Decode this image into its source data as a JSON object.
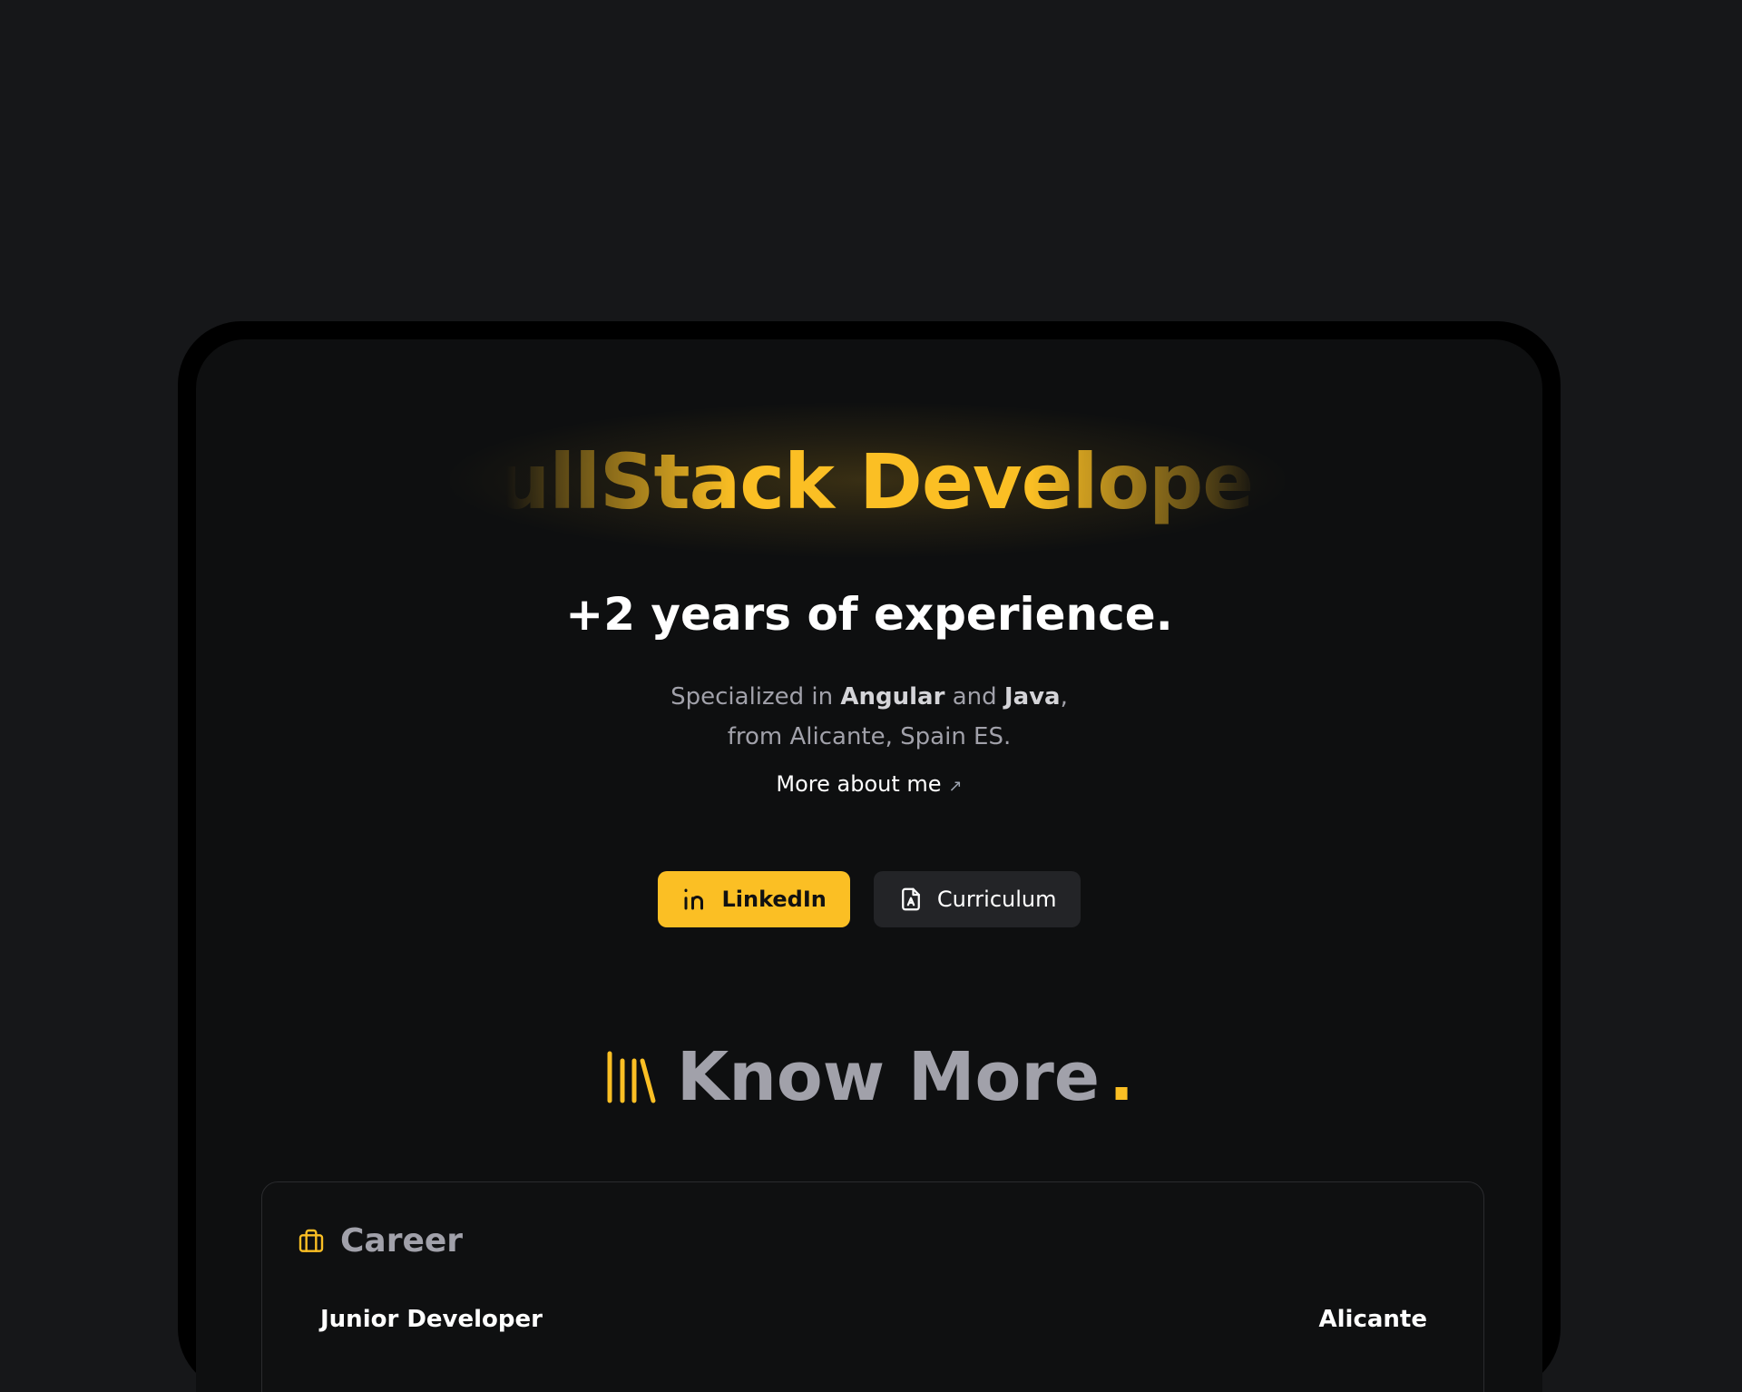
{
  "hero": {
    "title": "FullStack Developer",
    "subtitle": "+2 years of experience.",
    "desc_prefix": "Specialized in ",
    "desc_skill_1": "Angular",
    "desc_and": " and ",
    "desc_skill_2": "Java",
    "desc_comma": ",",
    "desc_line2": "from Alicante, Spain ES.",
    "more_link": "More about me",
    "more_arrow": "↗"
  },
  "buttons": {
    "linkedin_label": "LinkedIn",
    "curriculum_label": "Curriculum"
  },
  "section": {
    "title": "Know More",
    "dot": "."
  },
  "career": {
    "heading": "Career",
    "jobs": [
      {
        "role": "Junior Developer",
        "location": "Alicante"
      }
    ]
  },
  "icons": {
    "linkedin": "linkedin-icon",
    "curriculum": "file-document-icon",
    "books": "books-icon",
    "career": "briefcase-icon"
  },
  "colors": {
    "accent": "#fbbf24",
    "background": "#161719",
    "screen": "#0e0f10",
    "muted_text": "#a1a1aa",
    "secondary_button": "#232427"
  }
}
